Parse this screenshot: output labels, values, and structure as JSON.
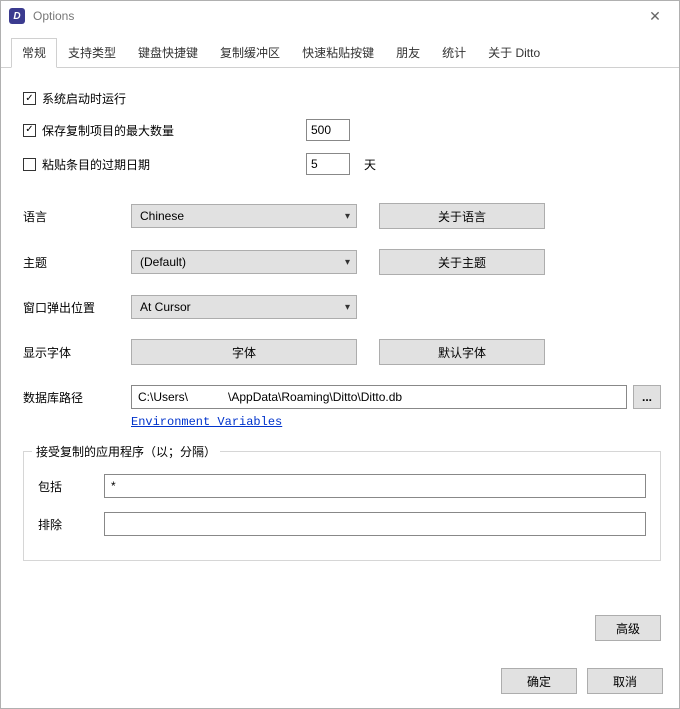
{
  "window": {
    "title": "Options"
  },
  "tabs": [
    "常规",
    "支持类型",
    "键盘快捷键",
    "复制缓冲区",
    "快速粘贴按键",
    "朋友",
    "统计",
    "关于 Ditto"
  ],
  "checkboxes": {
    "runAtStartup": {
      "label": "系统启动时运行",
      "checked": true
    },
    "maxCopies": {
      "label": "保存复制项目的最大数量",
      "checked": true,
      "value": "500"
    },
    "expire": {
      "label": "粘贴条目的过期日期",
      "checked": false,
      "value": "5",
      "unit": "天"
    }
  },
  "labels": {
    "language": "语言",
    "theme": "主题",
    "popupPos": "窗口弹出位置",
    "displayFont": "显示字体",
    "dbPath": "数据库路径",
    "include": "包括",
    "exclude": "排除"
  },
  "selects": {
    "language": "Chinese",
    "theme": "(Default)",
    "popupPos": "At Cursor"
  },
  "buttons": {
    "aboutLang": "关于语言",
    "aboutTheme": "关于主题",
    "font": "字体",
    "defaultFont": "默认字体",
    "browse": "...",
    "advanced": "高级",
    "ok": "确定",
    "cancel": "取消"
  },
  "dbPath": "C:\\Users\\            \\AppData\\Roaming\\Ditto\\Ditto.db",
  "envVarsLink": "Environment Variables",
  "groupTitle": "接受复制的应用程序（以；分隔）",
  "include": "*",
  "exclude": ""
}
